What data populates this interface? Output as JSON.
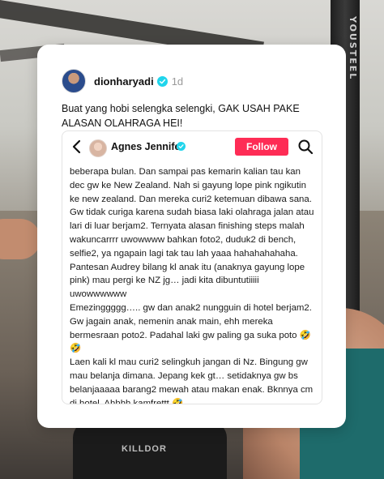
{
  "post": {
    "username": "dionharyadi",
    "time": "1d",
    "caption": "Buat yang hobi selengka selengki, GAK USAH PAKE ALASAN OLAHRAGA HEI!"
  },
  "embedded": {
    "profile_name": "Agnes Jennifer",
    "follow_label": "Follow",
    "paragraphs": [
      "beberapa bulan. Dan sampai pas kemarin kalian tau kan dec gw ke New Zealand. Nah si gayung lope pink ngikutin ke new zealand. Dan mereka curi2 ketemuan dibawa sana. Gw tidak curiga karena sudah biasa laki olahraga jalan atau lari di luar berjam2. Ternyata alasan finishing steps malah wakuncarrrr uwowwww bahkan foto2, duduk2 di bench, selfie2, ya ngapain lagi tak tau lah yaaa hahahahahaha. Pantesan Audrey bilang kl anak itu (anaknya gayung lope pink) mau pergi ke NZ jg… jadi kita dibuntutiiiii uwowwwwww",
      "Emezinggggg….. gw dan anak2 nungguin di hotel berjam2. Gw jagain anak, nemenin anak main, ehh mereka bermesraan poto2. Padahal laki gw paling ga suka poto 🤣🤣",
      "Laen kali kl mau curi2 selingkuh jangan di Nz. Bingung gw mau belanja dimana. Jepang kek gt… setidaknya gw bs belanjaaaaa barang2 mewah atau makan enak. Bknnya cm di hotel. Ahhhh kamfrettt 🤣"
    ]
  },
  "background": {
    "pole_text": "YOUSTEEL",
    "legs_text": "KILLDOR"
  },
  "colors": {
    "follow_button": "#fe2c55",
    "verified_badge": "#20d5ec",
    "timestamp": "#9a9a9a"
  },
  "icons": {
    "back": "chevron-left-icon",
    "search": "search-icon",
    "verified": "verified-badge-icon"
  }
}
